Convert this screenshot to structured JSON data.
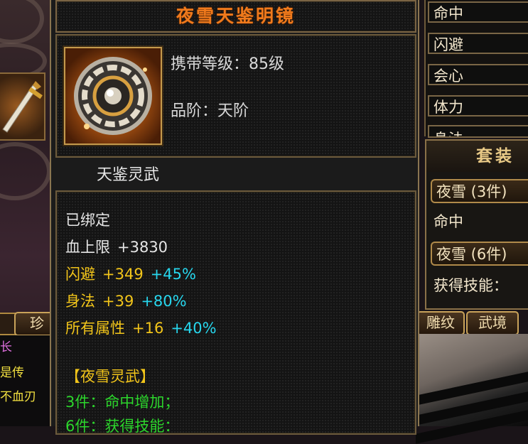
{
  "item": {
    "name": "夜雪天鉴明镜",
    "carry_level": "携带等级：85级",
    "grade": "品阶：天阶",
    "weapon_type": "天鉴灵武"
  },
  "stats": {
    "bound": "已绑定",
    "lines": [
      {
        "name": "血上限",
        "value": "+3830",
        "bonus": ""
      },
      {
        "name": "闪避",
        "value": "+349",
        "bonus": "+45%"
      },
      {
        "name": "身法",
        "value": "+39",
        "bonus": "+80%"
      },
      {
        "name": "所有属性",
        "value": "+16",
        "bonus": "+40%"
      }
    ],
    "set_header": "【夜雪灵武】",
    "set_bonus_3": "3件：命中增加；",
    "set_bonus_6": "6件：获得技能："
  },
  "attr_panel": {
    "rows": [
      "命中",
      "闪避",
      "会心",
      "体力",
      "身法"
    ]
  },
  "set_panel": {
    "title": "套装",
    "chip_3": "夜雪 (3件)",
    "text_3": "命中",
    "chip_6": "夜雪 (6件)",
    "text_6": "获得技能："
  },
  "tabs": {
    "left": "珍",
    "right_1": "雕纹",
    "right_2": "武境"
  },
  "chat": {
    "line1": "长",
    "line2": "是传",
    "line3": "不血刃"
  },
  "colors": {
    "title_orange": "#f07a1c",
    "stat_yellow": "#f2c51a",
    "bonus_cyan": "#27d7ee",
    "set_green": "#2cd62c"
  }
}
